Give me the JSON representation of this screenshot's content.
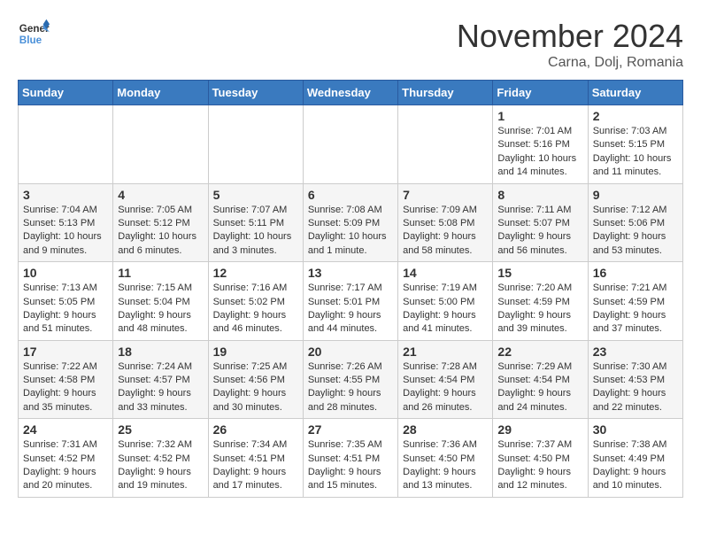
{
  "logo": {
    "line1": "General",
    "line2": "Blue"
  },
  "title": "November 2024",
  "subtitle": "Carna, Dolj, Romania",
  "days_of_week": [
    "Sunday",
    "Monday",
    "Tuesday",
    "Wednesday",
    "Thursday",
    "Friday",
    "Saturday"
  ],
  "weeks": [
    [
      {
        "day": "",
        "info": ""
      },
      {
        "day": "",
        "info": ""
      },
      {
        "day": "",
        "info": ""
      },
      {
        "day": "",
        "info": ""
      },
      {
        "day": "",
        "info": ""
      },
      {
        "day": "1",
        "info": "Sunrise: 7:01 AM\nSunset: 5:16 PM\nDaylight: 10 hours\nand 14 minutes."
      },
      {
        "day": "2",
        "info": "Sunrise: 7:03 AM\nSunset: 5:15 PM\nDaylight: 10 hours\nand 11 minutes."
      }
    ],
    [
      {
        "day": "3",
        "info": "Sunrise: 7:04 AM\nSunset: 5:13 PM\nDaylight: 10 hours\nand 9 minutes."
      },
      {
        "day": "4",
        "info": "Sunrise: 7:05 AM\nSunset: 5:12 PM\nDaylight: 10 hours\nand 6 minutes."
      },
      {
        "day": "5",
        "info": "Sunrise: 7:07 AM\nSunset: 5:11 PM\nDaylight: 10 hours\nand 3 minutes."
      },
      {
        "day": "6",
        "info": "Sunrise: 7:08 AM\nSunset: 5:09 PM\nDaylight: 10 hours\nand 1 minute."
      },
      {
        "day": "7",
        "info": "Sunrise: 7:09 AM\nSunset: 5:08 PM\nDaylight: 9 hours\nand 58 minutes."
      },
      {
        "day": "8",
        "info": "Sunrise: 7:11 AM\nSunset: 5:07 PM\nDaylight: 9 hours\nand 56 minutes."
      },
      {
        "day": "9",
        "info": "Sunrise: 7:12 AM\nSunset: 5:06 PM\nDaylight: 9 hours\nand 53 minutes."
      }
    ],
    [
      {
        "day": "10",
        "info": "Sunrise: 7:13 AM\nSunset: 5:05 PM\nDaylight: 9 hours\nand 51 minutes."
      },
      {
        "day": "11",
        "info": "Sunrise: 7:15 AM\nSunset: 5:04 PM\nDaylight: 9 hours\nand 48 minutes."
      },
      {
        "day": "12",
        "info": "Sunrise: 7:16 AM\nSunset: 5:02 PM\nDaylight: 9 hours\nand 46 minutes."
      },
      {
        "day": "13",
        "info": "Sunrise: 7:17 AM\nSunset: 5:01 PM\nDaylight: 9 hours\nand 44 minutes."
      },
      {
        "day": "14",
        "info": "Sunrise: 7:19 AM\nSunset: 5:00 PM\nDaylight: 9 hours\nand 41 minutes."
      },
      {
        "day": "15",
        "info": "Sunrise: 7:20 AM\nSunset: 4:59 PM\nDaylight: 9 hours\nand 39 minutes."
      },
      {
        "day": "16",
        "info": "Sunrise: 7:21 AM\nSunset: 4:59 PM\nDaylight: 9 hours\nand 37 minutes."
      }
    ],
    [
      {
        "day": "17",
        "info": "Sunrise: 7:22 AM\nSunset: 4:58 PM\nDaylight: 9 hours\nand 35 minutes."
      },
      {
        "day": "18",
        "info": "Sunrise: 7:24 AM\nSunset: 4:57 PM\nDaylight: 9 hours\nand 33 minutes."
      },
      {
        "day": "19",
        "info": "Sunrise: 7:25 AM\nSunset: 4:56 PM\nDaylight: 9 hours\nand 30 minutes."
      },
      {
        "day": "20",
        "info": "Sunrise: 7:26 AM\nSunset: 4:55 PM\nDaylight: 9 hours\nand 28 minutes."
      },
      {
        "day": "21",
        "info": "Sunrise: 7:28 AM\nSunset: 4:54 PM\nDaylight: 9 hours\nand 26 minutes."
      },
      {
        "day": "22",
        "info": "Sunrise: 7:29 AM\nSunset: 4:54 PM\nDaylight: 9 hours\nand 24 minutes."
      },
      {
        "day": "23",
        "info": "Sunrise: 7:30 AM\nSunset: 4:53 PM\nDaylight: 9 hours\nand 22 minutes."
      }
    ],
    [
      {
        "day": "24",
        "info": "Sunrise: 7:31 AM\nSunset: 4:52 PM\nDaylight: 9 hours\nand 20 minutes."
      },
      {
        "day": "25",
        "info": "Sunrise: 7:32 AM\nSunset: 4:52 PM\nDaylight: 9 hours\nand 19 minutes."
      },
      {
        "day": "26",
        "info": "Sunrise: 7:34 AM\nSunset: 4:51 PM\nDaylight: 9 hours\nand 17 minutes."
      },
      {
        "day": "27",
        "info": "Sunrise: 7:35 AM\nSunset: 4:51 PM\nDaylight: 9 hours\nand 15 minutes."
      },
      {
        "day": "28",
        "info": "Sunrise: 7:36 AM\nSunset: 4:50 PM\nDaylight: 9 hours\nand 13 minutes."
      },
      {
        "day": "29",
        "info": "Sunrise: 7:37 AM\nSunset: 4:50 PM\nDaylight: 9 hours\nand 12 minutes."
      },
      {
        "day": "30",
        "info": "Sunrise: 7:38 AM\nSunset: 4:49 PM\nDaylight: 9 hours\nand 10 minutes."
      }
    ]
  ]
}
